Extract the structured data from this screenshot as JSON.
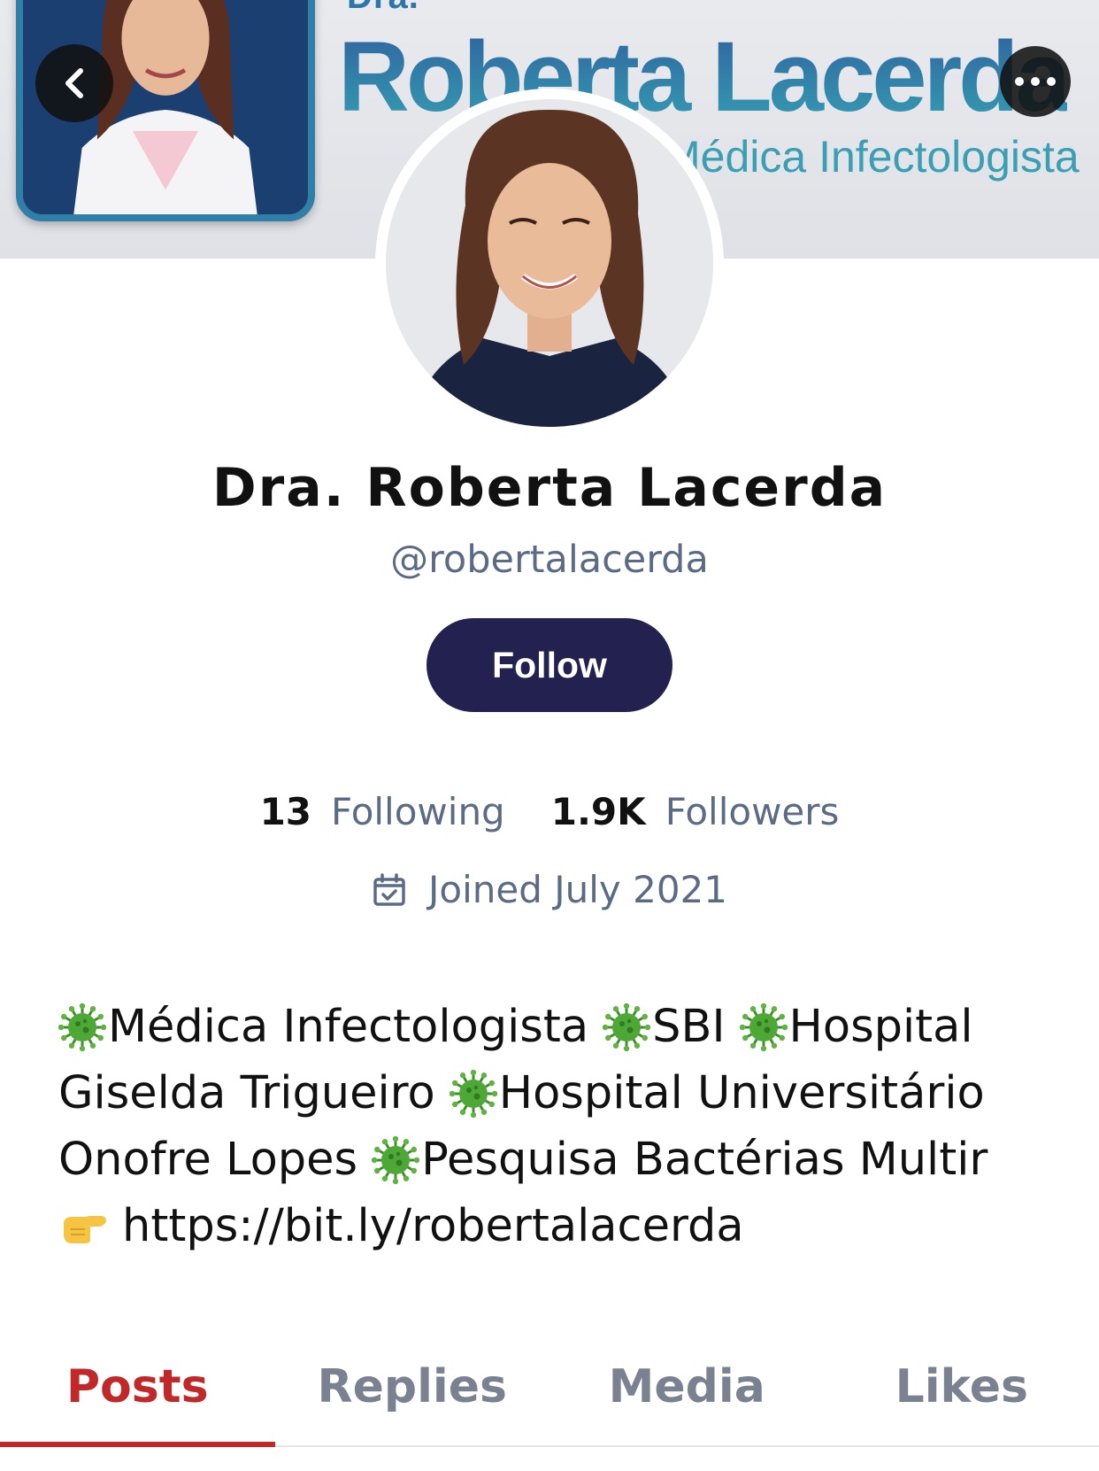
{
  "banner": {
    "pre_title": "Dra.",
    "name": "Roberta Lacerda",
    "subtitle": "Médica Infectologista"
  },
  "nav": {
    "back_icon": "chevron-left-icon",
    "more_icon": "more-horizontal-icon"
  },
  "profile": {
    "display_name": "Dra. Roberta Lacerda",
    "handle": "@robertalacerda",
    "follow_label": "Follow",
    "following_count": "13",
    "following_label": "Following",
    "followers_count": "1.9K",
    "followers_label": "Followers",
    "joined_icon": "calendar-icon",
    "joined_text": "Joined July 2021"
  },
  "bio": {
    "segment_icon": "virus-emoji-icon",
    "link_icon": "pointing-hand-emoji-icon",
    "segments": [
      "Médica Infectologista",
      "SBI",
      "Hospital",
      "Giselda Trigueiro",
      "Hospital Universitário",
      "Onofre Lopes",
      "Pesquisa Bactérias Multir"
    ],
    "link": "https://bit.ly/robertalacerda"
  },
  "tabs": [
    {
      "label": "Posts",
      "active": true
    },
    {
      "label": "Replies",
      "active": false
    },
    {
      "label": "Media",
      "active": false
    },
    {
      "label": "Likes",
      "active": false
    }
  ],
  "colors": {
    "follow_button": "#23214f",
    "active_tab": "#c0282a",
    "muted_text": "#5b6b85",
    "banner_accent": "#2b83aa"
  }
}
